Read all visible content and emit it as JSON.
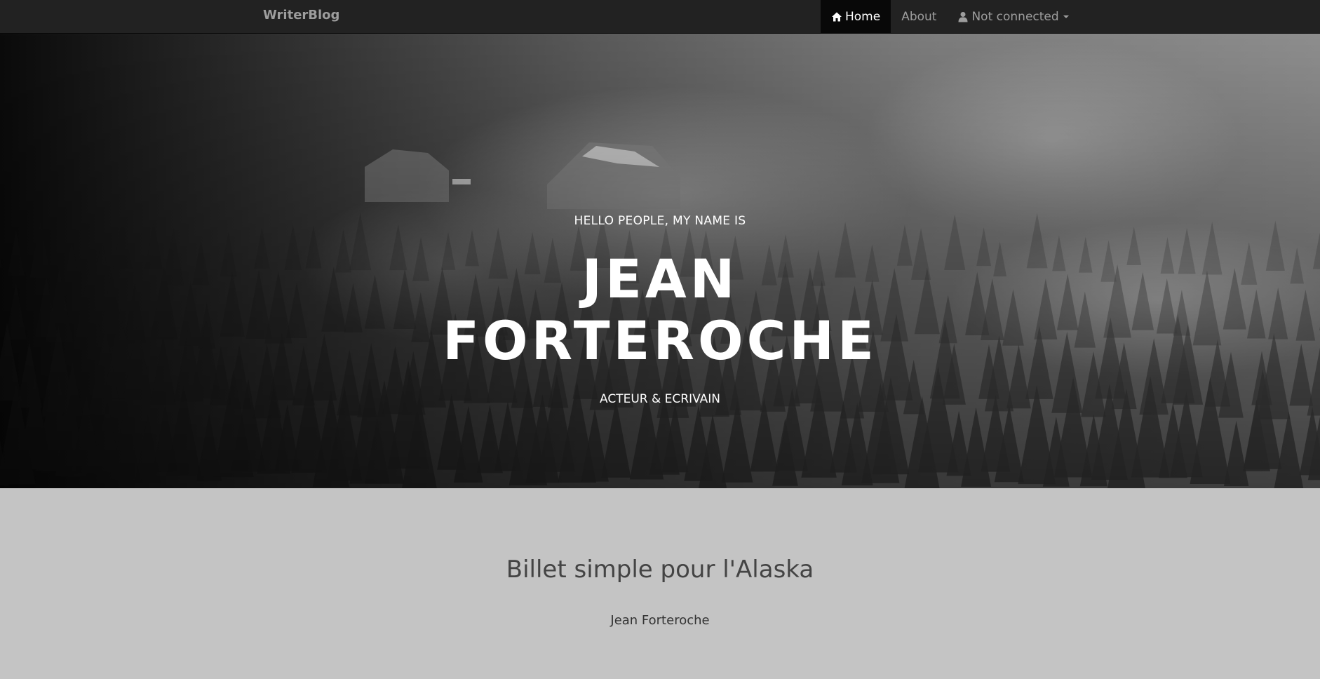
{
  "navbar": {
    "brand": "WriterBlog",
    "items": [
      {
        "label": "Home",
        "icon": "home-icon",
        "active": true
      },
      {
        "label": "About"
      },
      {
        "label": "Not connected",
        "icon": "user-icon",
        "dropdown": true
      }
    ]
  },
  "hero": {
    "intro": "HELLO PEOPLE, MY NAME IS",
    "name_line1": "JEAN",
    "name_line2": "FORTEROCHE",
    "subtitle": "ACTEUR & ECRIVAIN"
  },
  "content": {
    "book_title": "Billet simple pour l'Alaska",
    "author": "Jean Forteroche"
  },
  "colors": {
    "navbar_bg": "#222222",
    "nav_active_bg": "#080808",
    "nav_text": "#9d9d9d",
    "content_bg": "#c4c4c4"
  }
}
